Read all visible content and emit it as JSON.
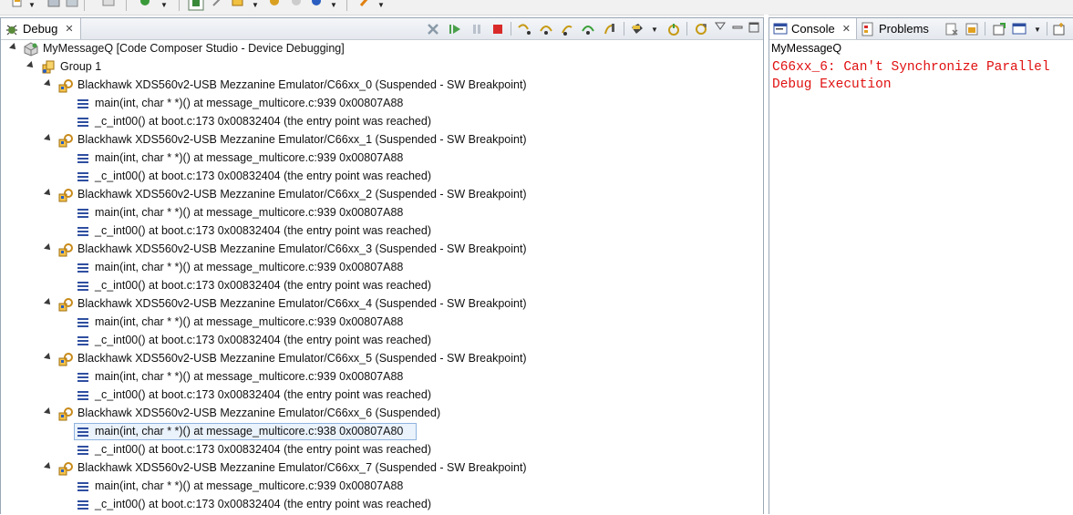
{
  "toolbar": {
    "icons": [
      "new-icon",
      "save-icon",
      "save-all-icon",
      "print-icon",
      "debug-icon",
      "terminate-icon",
      "connect-icon",
      "run-icon",
      "breakpoint-icon",
      "search-icon",
      "circle-icon",
      "ext-tools-icon"
    ]
  },
  "debug": {
    "tab_label": "Debug",
    "toolbar_icons": [
      "remove-all-terminated-icon",
      "resume-icon",
      "suspend-icon",
      "terminate-icon",
      "step-into-icon",
      "step-over-icon",
      "step-return-icon",
      "assembly-step-into-icon",
      "assembly-step-over-icon",
      "connect-target-icon",
      "reset-icon",
      "restart-icon",
      "view-menu-icon",
      "minimize-icon",
      "maximize-icon"
    ],
    "tree": {
      "root_label": "MyMessageQ [Code Composer Studio - Device Debugging]",
      "group_label": "Group 1",
      "cores": [
        {
          "label": "Blackhawk XDS560v2-USB Mezzanine Emulator/C66xx_0 (Suspended - SW Breakpoint)",
          "frames": [
            "main(int, char * *)() at message_multicore.c:939 0x00807A88",
            "_c_int00() at boot.c:173 0x00832404  (the entry point was reached)"
          ]
        },
        {
          "label": "Blackhawk XDS560v2-USB Mezzanine Emulator/C66xx_1 (Suspended - SW Breakpoint)",
          "frames": [
            "main(int, char * *)() at message_multicore.c:939 0x00807A88",
            "_c_int00() at boot.c:173 0x00832404  (the entry point was reached)"
          ]
        },
        {
          "label": "Blackhawk XDS560v2-USB Mezzanine Emulator/C66xx_2 (Suspended - SW Breakpoint)",
          "frames": [
            "main(int, char * *)() at message_multicore.c:939 0x00807A88",
            "_c_int00() at boot.c:173 0x00832404  (the entry point was reached)"
          ]
        },
        {
          "label": "Blackhawk XDS560v2-USB Mezzanine Emulator/C66xx_3 (Suspended - SW Breakpoint)",
          "frames": [
            "main(int, char * *)() at message_multicore.c:939 0x00807A88",
            "_c_int00() at boot.c:173 0x00832404  (the entry point was reached)"
          ]
        },
        {
          "label": "Blackhawk XDS560v2-USB Mezzanine Emulator/C66xx_4 (Suspended - SW Breakpoint)",
          "frames": [
            "main(int, char * *)() at message_multicore.c:939 0x00807A88",
            "_c_int00() at boot.c:173 0x00832404  (the entry point was reached)"
          ]
        },
        {
          "label": "Blackhawk XDS560v2-USB Mezzanine Emulator/C66xx_5 (Suspended - SW Breakpoint)",
          "frames": [
            "main(int, char * *)() at message_multicore.c:939 0x00807A88",
            "_c_int00() at boot.c:173 0x00832404  (the entry point was reached)"
          ]
        },
        {
          "label": "Blackhawk XDS560v2-USB Mezzanine Emulator/C66xx_6 (Suspended)",
          "frames": [
            "main(int, char * *)() at message_multicore.c:938 0x00807A80",
            "_c_int00() at boot.c:173 0x00832404  (the entry point was reached)"
          ]
        },
        {
          "label": "Blackhawk XDS560v2-USB Mezzanine Emulator/C66xx_7 (Suspended - SW Breakpoint)",
          "frames": [
            "main(int, char * *)() at message_multicore.c:939 0x00807A88",
            "_c_int00() at boot.c:173 0x00832404  (the entry point was reached)"
          ]
        }
      ],
      "selected_core": 6,
      "selected_frame": 0
    }
  },
  "console": {
    "tab_label": "Console",
    "problems_tab_label": "Problems",
    "toolbar_icons": [
      "clear-console-icon",
      "scroll-lock-icon",
      "pin-console-icon",
      "display-console-icon",
      "open-console-icon"
    ],
    "name": "MyMessageQ",
    "output": "C66xx_6: Can't Synchronize Parallel Debug Execution",
    "output_color": "#e01010"
  },
  "colors": {
    "selection_bg": "#eaf2fb",
    "selection_border": "#8fb4de",
    "frame_icon": "#2f4fa0",
    "core_icon": "#c88a1a"
  }
}
